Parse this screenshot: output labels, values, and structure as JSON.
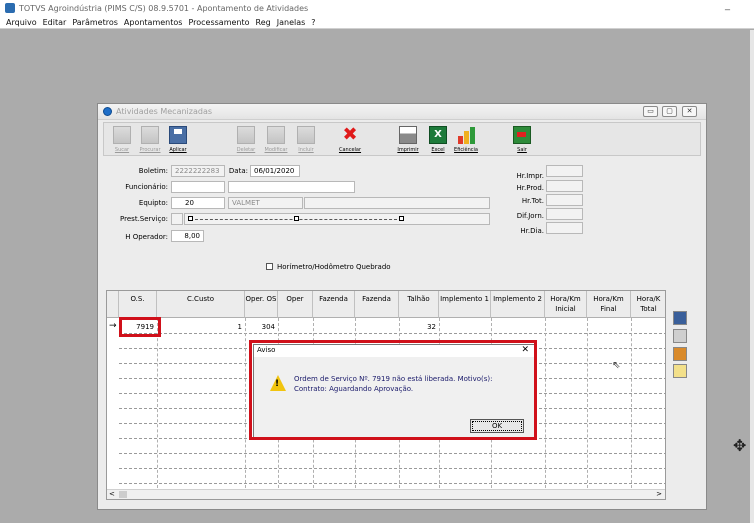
{
  "app": {
    "title": "TOTVS Agroindústria (PIMS C/S) 08.9.5701 - Apontamento de Atividades",
    "minimize_glyph": "_"
  },
  "menu": [
    "Arquivo",
    "Editar",
    "Parâmetros",
    "Apontamentos",
    "Processamento",
    "Reg",
    "Janelas",
    "?"
  ],
  "window": {
    "title": "Atividades Mecanizadas",
    "controls": [
      "▭",
      "▢",
      "✕"
    ]
  },
  "toolbar": [
    {
      "label": "Sucar",
      "icon": "blank-icon",
      "enabled": false
    },
    {
      "label": "Procurar",
      "icon": "blank-icon",
      "enabled": false
    },
    {
      "label": "Aplicar",
      "icon": "save-icon",
      "enabled": true
    },
    {
      "label": "Deletar",
      "icon": "blank-icon",
      "enabled": false
    },
    {
      "label": "Modificar",
      "icon": "blank-icon",
      "enabled": false
    },
    {
      "label": "Incluir",
      "icon": "blank-icon",
      "enabled": false
    },
    {
      "label": "Cancelar",
      "icon": "cancel-icon",
      "enabled": true
    },
    {
      "label": "Imprimir",
      "icon": "print-icon",
      "enabled": true
    },
    {
      "label": "Excel",
      "icon": "excel-icon",
      "enabled": true
    },
    {
      "label": "Eficiência",
      "icon": "chart-icon",
      "enabled": true
    },
    {
      "label": "Sair",
      "icon": "exit-icon",
      "enabled": true
    }
  ],
  "form": {
    "boletim_label": "Boletim:",
    "boletim_value": "2222222283",
    "data_label": "Data:",
    "data_value": "06/01/2020",
    "funcionario_label": "Funcionário:",
    "funcionario_value": "",
    "funcionario_name": "",
    "equipto_label": "Equipto:",
    "equipto_value": "20",
    "equipto_name": "VALMET",
    "prest_label": "Prest.Serviço:",
    "prest_value": "",
    "hoperador_label": "H Operador:",
    "hoperador_value": "8,00",
    "hr_impr_label": "Hr.Impr.",
    "hr_prod_label": "Hr.Prod.",
    "hr_tot_label": "Hr.Tot.",
    "dif_jorn_label": "Dif.Jorn.",
    "hr_dia_label": "Hr.Dia.",
    "horimetro_label": "Horímetro/Hodômetro Quebrado",
    "horimetro_checked": false
  },
  "grid": {
    "columns": [
      "O.S.",
      "C.Custo",
      "Oper. OS",
      "Oper",
      "Fazenda",
      "Fazenda",
      "Talhão",
      "Implemento 1",
      "Implemento 2",
      "Hora/Km Inicial",
      "Hora/Km Final",
      "Hora/K Total"
    ],
    "rows": [
      {
        "os": "7919",
        "ccusto": "1",
        "oper_os": "304",
        "talhao": "32"
      }
    ],
    "row_indicator": "→",
    "scroll_left": "<",
    "scroll_right": ">"
  },
  "dialog": {
    "title": "Aviso",
    "close": "✕",
    "message": "Ordem de Serviço Nº. 7919 não está liberada. Motivo(s): Contrato: Aguardando Aprovação.",
    "ok_label": "OK"
  },
  "colors": {
    "highlight": "#d0101a",
    "warning": "#f1c40f",
    "workspace": "#ababab"
  }
}
